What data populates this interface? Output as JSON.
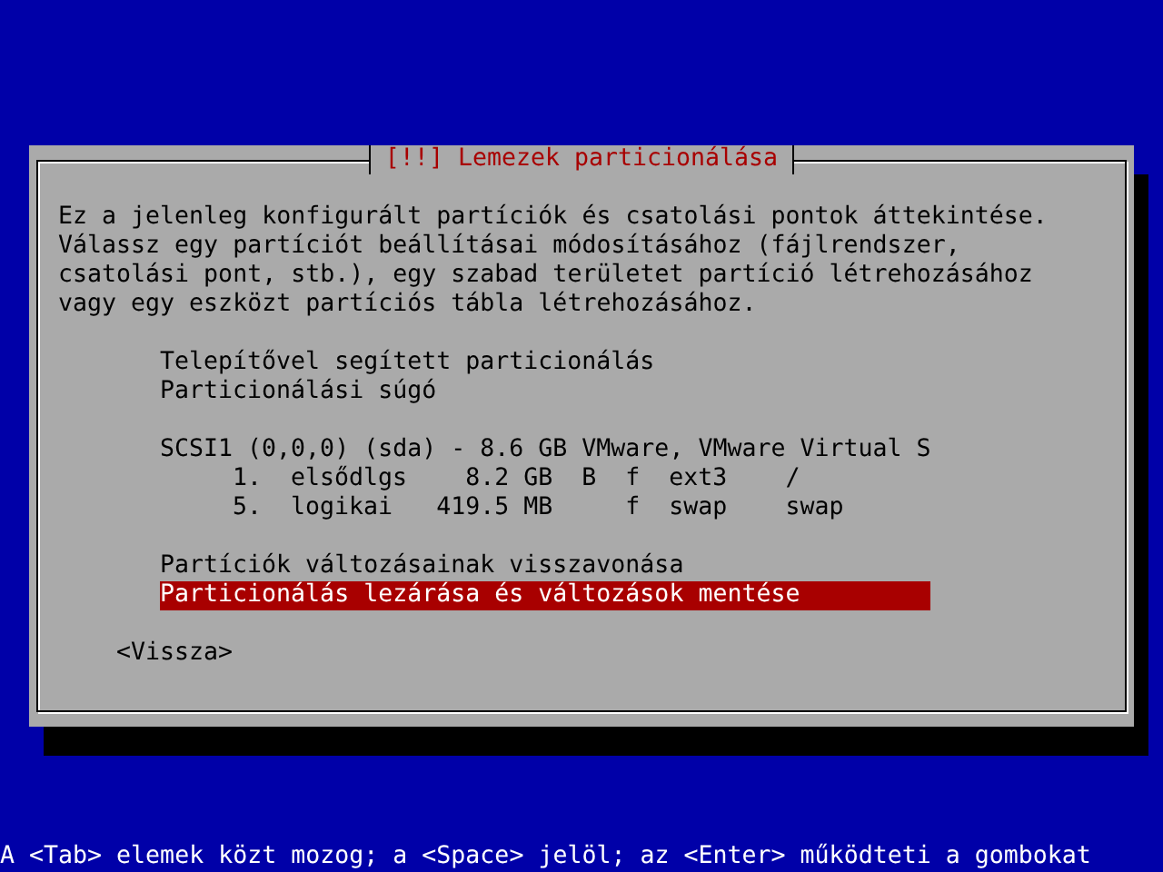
{
  "dialog": {
    "title": "[!!] Lemezek particionálása",
    "intro": "Ez a jelenleg konfigurált partíciók és csatolási pontok áttekintése.\nVálassz egy partíciót beállításai módosításához (fájlrendszer,\ncsatolási pont, stb.), egy szabad területet partíció létrehozásához\nvagy egy eszközt partíciós tábla létrehozásához.",
    "menu_groups": [
      [
        {
          "label": "Telepítővel segített particionálás",
          "selected": false
        },
        {
          "label": "Particionálási súgó",
          "selected": false
        }
      ],
      [
        {
          "label": "SCSI1 (0,0,0) (sda) - 8.6 GB VMware, VMware Virtual S",
          "selected": false,
          "children": [
            {
              "label": "1.  elsődlgs    8.2 GB  B  f  ext3    /",
              "selected": false
            },
            {
              "label": "5.  logikai   419.5 MB     f  swap    swap",
              "selected": false
            }
          ]
        }
      ],
      [
        {
          "label": "Partíciók változásainak visszavonása",
          "selected": false
        },
        {
          "label": "Particionálás lezárása és változások mentése",
          "selected": true
        }
      ]
    ],
    "back_button": "<Vissza>"
  },
  "status_bar": "A <Tab> elemek közt mozog; a <Space> jelöl; az <Enter> működteti a gombokat"
}
